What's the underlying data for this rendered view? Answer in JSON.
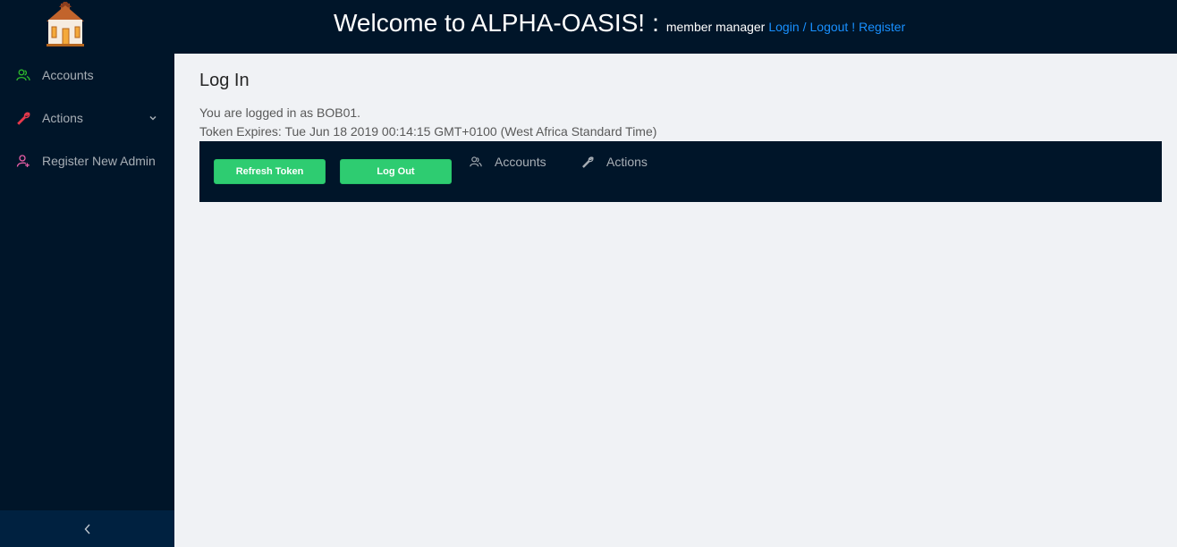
{
  "header": {
    "title": "Welcome to ALPHA-OASIS!",
    "separator": ":",
    "subtitle": "member manager",
    "links": {
      "login": "Login",
      "divider": "/",
      "logout": "Logout !",
      "register": "Register"
    }
  },
  "sidebar": {
    "items": [
      {
        "label": "Accounts",
        "icon": "accounts-icon",
        "icon_color": "#2db82d"
      },
      {
        "label": "Actions",
        "icon": "wrench-icon",
        "icon_color": "#e8394c",
        "expandable": true
      },
      {
        "label": "Register New Admin",
        "icon": "add-user-icon",
        "icon_color": "#eb5fa8"
      }
    ],
    "collapse_icon": "chevron-left-icon"
  },
  "main": {
    "title": "Log In",
    "logged_in_text": "You are logged in as BOB01.",
    "token_text": "Token Expires: Tue Jun 18 2019 00:14:15 GMT+0100 (West Africa Standard Time)",
    "toolbar": {
      "refresh_label": "Refresh Token",
      "logout_label": "Log Out",
      "accounts_label": "Accounts",
      "actions_label": "Actions"
    }
  },
  "colors": {
    "header_bg": "#001529",
    "sidebar_bg": "#001529",
    "content_bg": "#f0f2f5",
    "link": "#1890ff",
    "button": "#2ecc71"
  }
}
